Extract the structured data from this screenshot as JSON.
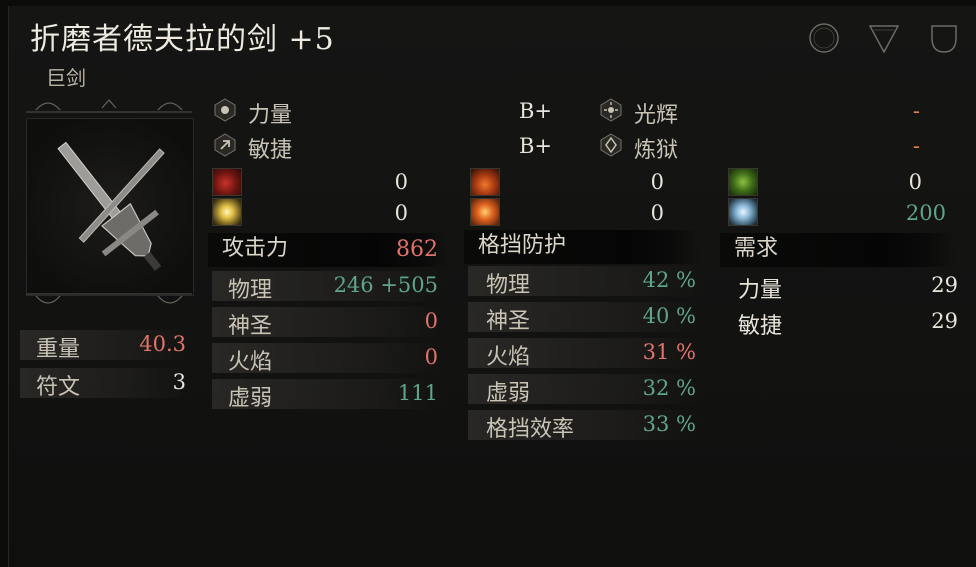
{
  "header": {
    "title": "折磨者德夫拉的剑 +5",
    "subtitle": "巨剑"
  },
  "attributes": {
    "strength": {
      "label": "力量",
      "scaling": "B+"
    },
    "dexterity": {
      "label": "敏捷",
      "scaling": "B+"
    },
    "radiance": {
      "label": "光辉",
      "scaling": "-"
    },
    "inferno": {
      "label": "炼狱",
      "scaling": "-"
    }
  },
  "elements": {
    "col1": [
      "0",
      "0"
    ],
    "col2": [
      "0",
      "0"
    ],
    "col3": [
      "0",
      "200"
    ]
  },
  "weight": {
    "label": "重量",
    "value": "40.3"
  },
  "runes": {
    "label": "符文",
    "value": "3"
  },
  "attack": {
    "heading": "攻击力",
    "total": "862",
    "rows": [
      {
        "label": "物理",
        "value": "246 +505"
      },
      {
        "label": "神圣",
        "value": "0"
      },
      {
        "label": "火焰",
        "value": "0"
      },
      {
        "label": "虚弱",
        "value": "111"
      }
    ]
  },
  "guard": {
    "heading": "格挡防护",
    "rows": [
      {
        "label": "物理",
        "value": "42 %"
      },
      {
        "label": "神圣",
        "value": "40 %"
      },
      {
        "label": "火焰",
        "value": "31 %"
      },
      {
        "label": "虚弱",
        "value": "32 %"
      },
      {
        "label": "格挡效率",
        "value": "33 %"
      }
    ]
  },
  "requirements": {
    "heading": "需求",
    "rows": [
      {
        "label": "力量",
        "value": "29"
      },
      {
        "label": "敏捷",
        "value": "29"
      }
    ]
  },
  "colors": {
    "positive": "#5fa58a",
    "negative": "#e0746a",
    "scaling_missing": "#e0804a",
    "text": "#dedad0"
  },
  "icons": [
    "circle-ornament-icon",
    "triangle-ornament-icon",
    "cup-ornament-icon",
    "greatsword-icon",
    "strength-icon",
    "dexterity-icon",
    "radiance-icon",
    "inferno-icon"
  ]
}
